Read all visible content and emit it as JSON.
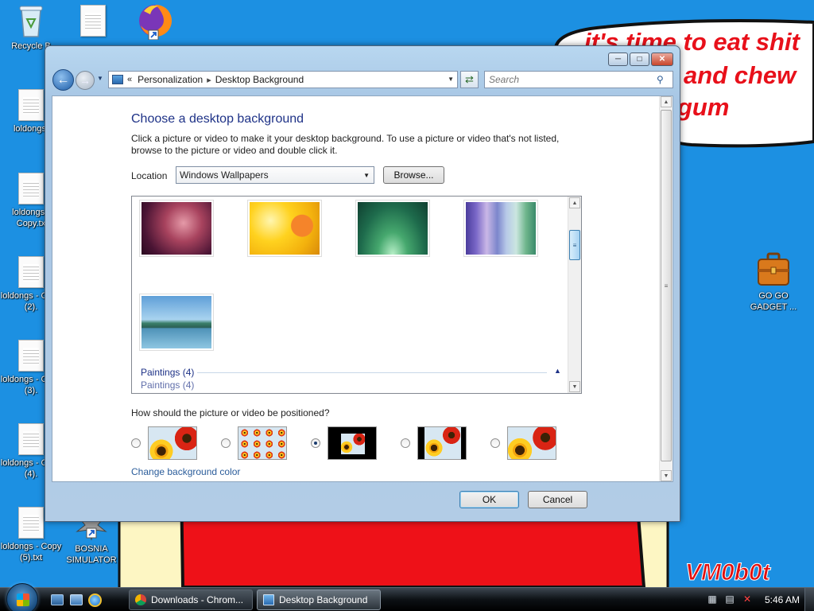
{
  "desktop": {
    "icons": [
      {
        "label": "Recycle B",
        "kind": "recycle-bin"
      },
      {
        "label": "",
        "kind": "text-file"
      },
      {
        "label": "",
        "kind": "firefox"
      },
      {
        "label": "loldongs.",
        "kind": "text-file"
      },
      {
        "label": "loldongs - Copy.tx",
        "kind": "text-file"
      },
      {
        "label": "loldongs - Copy (2).",
        "kind": "text-file"
      },
      {
        "label": "loldongs - Copy (3).",
        "kind": "text-file"
      },
      {
        "label": "loldongs - Copy (4).",
        "kind": "text-file"
      },
      {
        "label": "loldongs - Copy (5).txt",
        "kind": "text-file"
      },
      {
        "label": "BOSNIA SIMULATOR",
        "kind": "shortcut"
      },
      {
        "label": "GO GO GADGET ...",
        "kind": "briefcase"
      }
    ],
    "wallpaper_text": {
      "line1": "it's time to eat shit",
      "line2": "and chew",
      "line3": "gum",
      "signature": "VM0b0t"
    },
    "colors": {
      "sky": "#1c90e2",
      "meme_red": "#e8101a",
      "figure_red": "#ee1118",
      "cream": "#fdf6c3"
    }
  },
  "window": {
    "breadcrumb": {
      "root": "Personalization",
      "current": "Desktop Background"
    },
    "search_placeholder": "Search",
    "title": "Choose a desktop background",
    "description": "Click a picture or video to make it your desktop background. To use a picture or video that's not listed, browse to the picture or video and double click it.",
    "location": {
      "label": "Location",
      "value": "Windows Wallpapers"
    },
    "browse_label": "Browse...",
    "wallpapers": [
      {
        "name": "wallpaper-1"
      },
      {
        "name": "wallpaper-2"
      },
      {
        "name": "wallpaper-3"
      },
      {
        "name": "wallpaper-4"
      },
      {
        "name": "wallpaper-5"
      }
    ],
    "group": {
      "label": "Paintings (4)",
      "collapse_glyph": "▲"
    },
    "position_question": "How should the picture or video be positioned?",
    "position_options": [
      {
        "name": "fill",
        "selected": false
      },
      {
        "name": "tile",
        "selected": false
      },
      {
        "name": "center",
        "selected": true
      },
      {
        "name": "fit",
        "selected": false
      },
      {
        "name": "stretch",
        "selected": false
      }
    ],
    "change_color_label": "Change background color",
    "ok_label": "OK",
    "cancel_label": "Cancel"
  },
  "taskbar": {
    "tasks": [
      {
        "label": "Downloads - Chrom...",
        "active": false
      },
      {
        "label": "Desktop Background",
        "active": true
      }
    ],
    "clock": "5:46 AM"
  }
}
